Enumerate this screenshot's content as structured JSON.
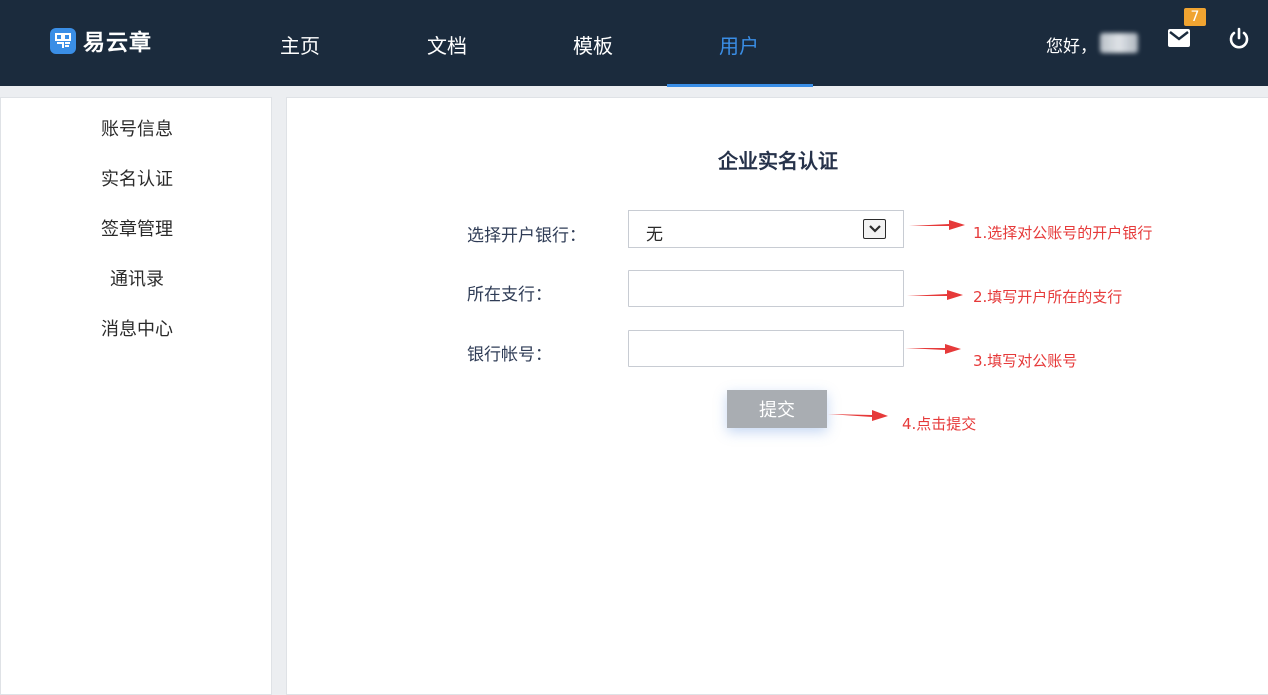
{
  "app": {
    "logo_text": "易云章"
  },
  "nav": {
    "items": [
      {
        "label": "主页"
      },
      {
        "label": "文档"
      },
      {
        "label": "模板"
      },
      {
        "label": "用户"
      }
    ],
    "active_index": 3,
    "greeting": "您好，",
    "mail_badge": "7"
  },
  "sidebar": {
    "items": [
      {
        "label": "账号信息"
      },
      {
        "label": "实名认证"
      },
      {
        "label": "签章管理"
      },
      {
        "label": "通讯录"
      },
      {
        "label": "消息中心"
      }
    ]
  },
  "form": {
    "title": "企业实名认证",
    "bank_label": "选择开户银行：",
    "bank_value": "无",
    "branch_label": "所在支行：",
    "branch_value": "",
    "account_label": "银行帐号：",
    "account_value": "",
    "submit_label": "提交"
  },
  "annotations": {
    "step1": "1.选择对公账号的开户银行",
    "step2": "2.填写开户所在的支行",
    "step3": "3.填写对公账号",
    "step4": "4.点击提交"
  },
  "colors": {
    "topbar": "#1b2b3d",
    "accent": "#3a8ee6",
    "badge": "#f0a431",
    "annotation": "#e63a3a"
  }
}
